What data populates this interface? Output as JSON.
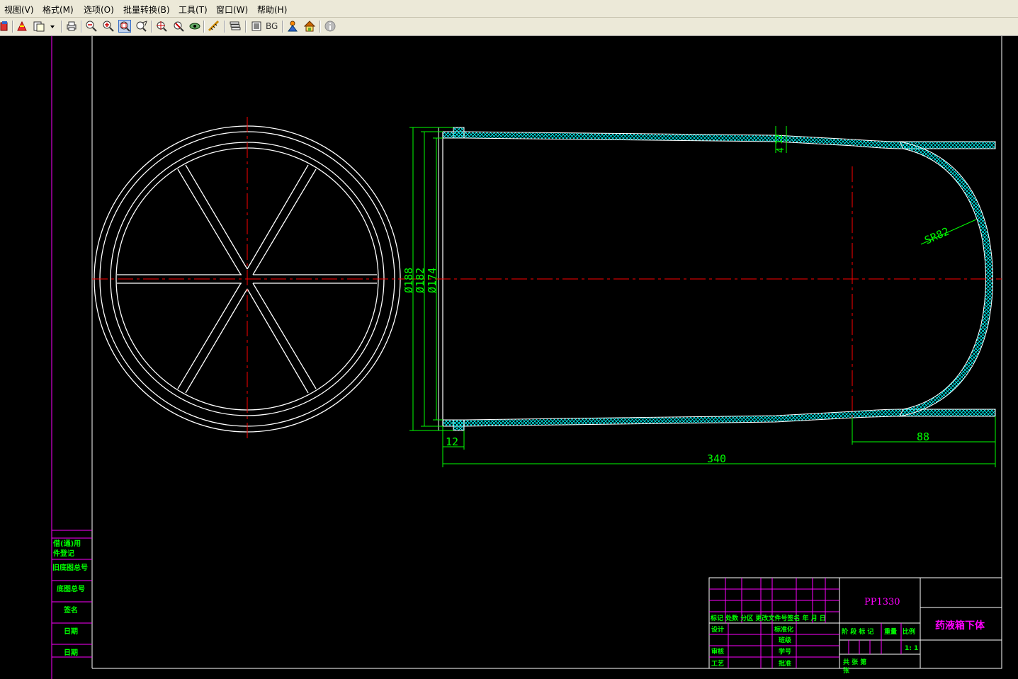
{
  "menu": {
    "view": "视图(V)",
    "format": "格式(M)",
    "options": "选项(O)",
    "batch": "批量转换(B)",
    "tools": "工具(T)",
    "window": "窗口(W)",
    "help": "帮助(H)"
  },
  "toolbar": {
    "bg_label": "BG",
    "icons": [
      "open-icon",
      "pdf-icon",
      "copy-icon",
      "dropdown-arrow-icon",
      "print-icon",
      "zoom-out-icon",
      "zoom-in-icon",
      "zoom-window-icon",
      "pan-icon",
      "zoom-extents-icon",
      "zoom-previous-icon",
      "layer-eye-icon",
      "measure-icon",
      "layers-icon",
      "frame-icon",
      "bg-button",
      "users-icon",
      "home-icon",
      "info-icon"
    ]
  },
  "drawing": {
    "dim_188": "Ø188",
    "dim_182": "Ø182",
    "dim_174": "Ø174",
    "dim_4": "4",
    "dim_12": "12",
    "dim_12b": "12",
    "dim_88": "88",
    "dim_340": "340",
    "dim_sr82": "SR82"
  },
  "side_table": {
    "row1": "借(通)用",
    "row2": "件登记",
    "row3": "旧底图总号",
    "row4": "底图总号",
    "row5": "签名",
    "row6": "日期",
    "row7": "日期"
  },
  "title_block": {
    "part_number": "PP1330",
    "part_name": "药液箱下体",
    "header_row": "标记 处数 分区 更改文件号签名 年 月 日",
    "design": "设计",
    "standardization": "标准化",
    "checked": "审核",
    "process": "工艺",
    "approved": "批准",
    "column_b": "班级",
    "student_no": "学号",
    "stage_label": "阶 段 标 记",
    "weight_label": "重量",
    "scale_label": "比例",
    "scale_value": "1: 1",
    "sheets_label": "共      张   第",
    "sheet_label2": "张"
  },
  "colors": {
    "background": "#000000",
    "geometry": "#ffffff",
    "centerline": "#ff0000",
    "dimension": "#00ff00",
    "hatch": "#00ffff",
    "frame": "#ff00ff",
    "title_text": "#ff00ff"
  }
}
